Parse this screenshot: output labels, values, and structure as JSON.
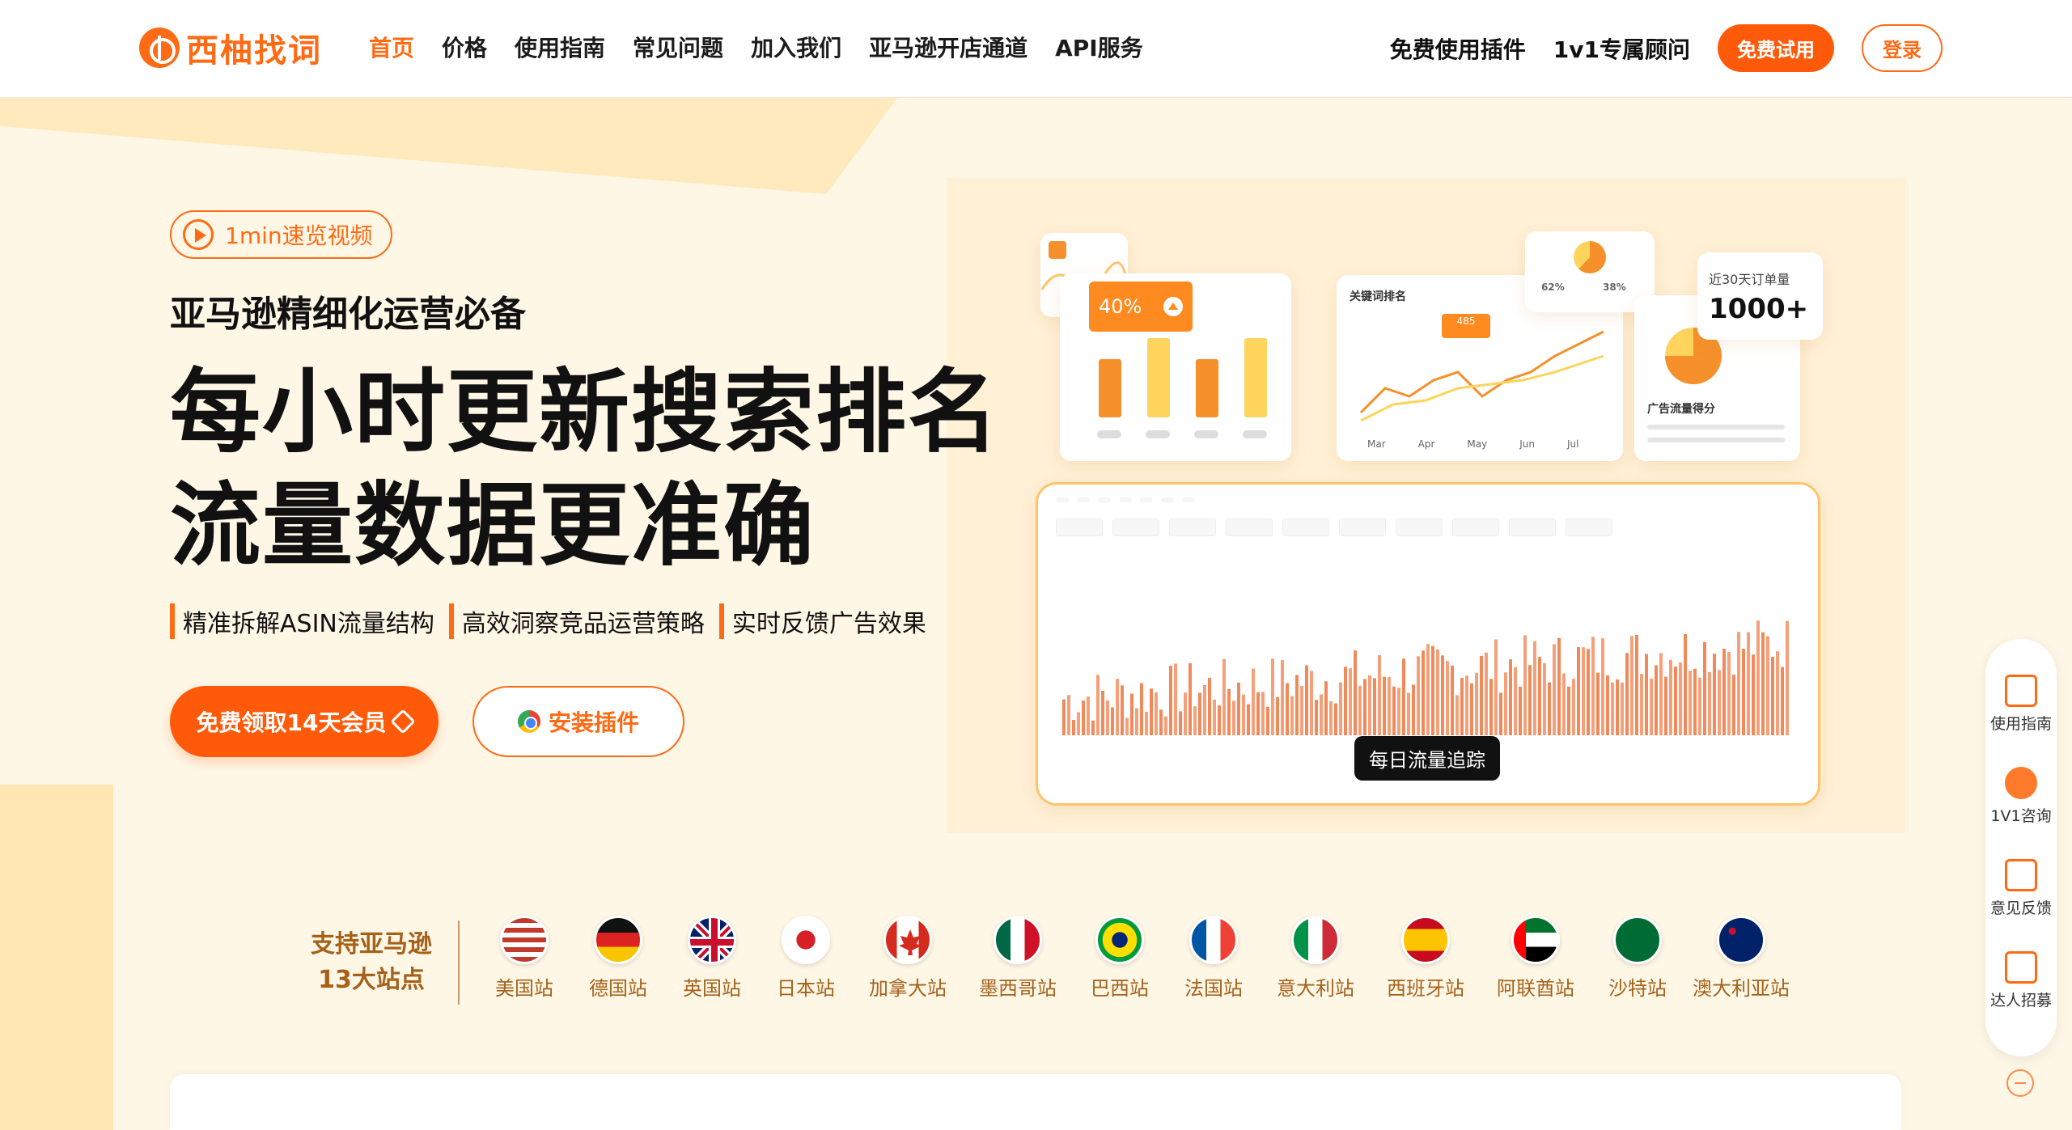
{
  "nav": {
    "brand": "西柚找词",
    "links": [
      "首页",
      "价格",
      "使用指南",
      "常见问题",
      "加入我们",
      "亚马逊开店通道",
      "API服务"
    ],
    "right": {
      "plugin": "免费使用插件",
      "consultant": "1v1专属顾问",
      "trial": "免费试用",
      "login": "登录"
    }
  },
  "hero": {
    "video": "1min速览视频",
    "subtitle": "亚马逊精细化运营必备",
    "headline_line1": "每小时更新搜索排名",
    "headline_line2": "流量数据更准确",
    "features": [
      "精准拆解ASIN流量结构",
      "高效洞察竞品运营策略",
      "实时反馈广告效果"
    ],
    "cta_primary": "免费领取14天会员",
    "cta_plugin": "安装插件"
  },
  "illustration": {
    "bar_tag": "40%",
    "keyword_rank_title": "关键词排名",
    "rank_value": "485",
    "months": [
      "Mar",
      "Apr",
      "May",
      "Jun",
      "Jul"
    ],
    "pie_left": "62%",
    "pie_right": "38%",
    "orders_label": "近30天订单量",
    "orders_value": "1000+",
    "ad_score_label": "广告流量得分",
    "daily_tracking": "每日流量追踪"
  },
  "marketplaces": {
    "title_line1": "支持亚马逊",
    "title_line2": "13大站点",
    "items": [
      {
        "label": "美国站",
        "flag": "us"
      },
      {
        "label": "德国站",
        "flag": "de"
      },
      {
        "label": "英国站",
        "flag": "uk"
      },
      {
        "label": "日本站",
        "flag": "jp"
      },
      {
        "label": "加拿大站",
        "flag": "ca"
      },
      {
        "label": "墨西哥站",
        "flag": "mx"
      },
      {
        "label": "巴西站",
        "flag": "br"
      },
      {
        "label": "法国站",
        "flag": "fr"
      },
      {
        "label": "意大利站",
        "flag": "it"
      },
      {
        "label": "西班牙站",
        "flag": "es"
      },
      {
        "label": "阿联酋站",
        "flag": "ae"
      },
      {
        "label": "沙特站",
        "flag": "sa"
      },
      {
        "label": "澳大利亚站",
        "flag": "au"
      }
    ]
  },
  "sidebar": {
    "items": [
      "使用指南",
      "1V1咨询",
      "意见反馈",
      "达人招募"
    ]
  },
  "colors": {
    "accent": "#ff6a14",
    "bg": "#fff7e6",
    "bar_orange": "#f5902a",
    "bar_yellow": "#ffd45c"
  }
}
